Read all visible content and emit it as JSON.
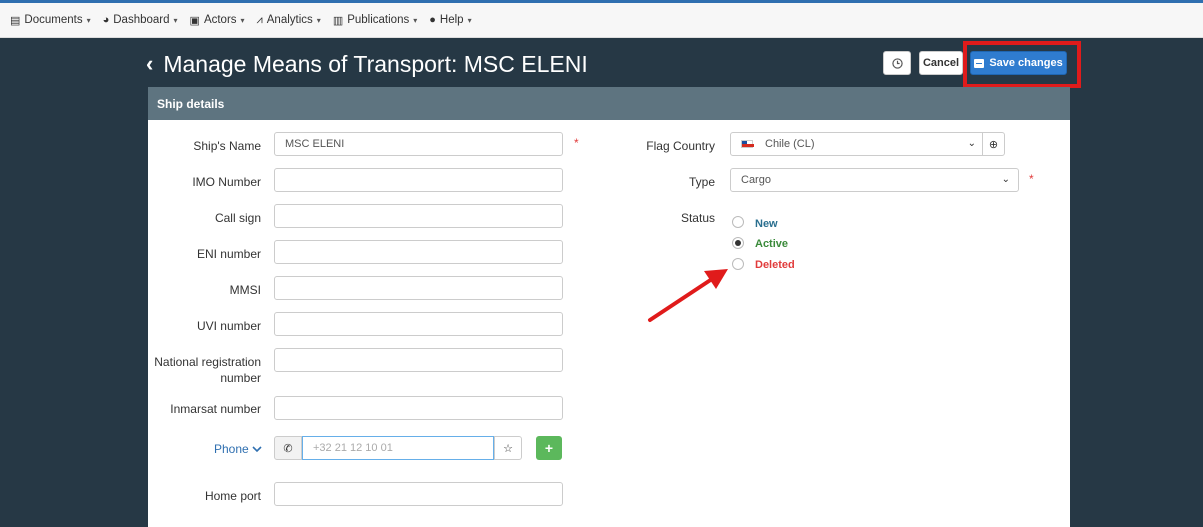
{
  "nav": {
    "items": [
      {
        "label": "Documents",
        "icon": "document-icon"
      },
      {
        "label": "Dashboard",
        "icon": "dashboard-icon"
      },
      {
        "label": "Actors",
        "icon": "id-card-icon"
      },
      {
        "label": "Analytics",
        "icon": "chart-icon"
      },
      {
        "label": "Publications",
        "icon": "book-icon"
      },
      {
        "label": "Help",
        "icon": "question-icon"
      }
    ]
  },
  "header": {
    "title": "Manage Means of Transport: MSC ELENI",
    "cancel_label": "Cancel",
    "save_label": "Save changes"
  },
  "panel": {
    "title": "Ship details"
  },
  "form": {
    "ship_name": {
      "label": "Ship's Name",
      "value": "MSC ELENI",
      "required": "*"
    },
    "imo_number": {
      "label": "IMO Number",
      "value": ""
    },
    "call_sign": {
      "label": "Call sign",
      "value": ""
    },
    "eni_number": {
      "label": "ENI number",
      "value": ""
    },
    "mmsi": {
      "label": "MMSI",
      "value": ""
    },
    "uvi_number": {
      "label": "UVI number",
      "value": ""
    },
    "national_registration": {
      "label_line1": "National registration",
      "label_line2": "number",
      "value": ""
    },
    "inmarsat_number": {
      "label": "Inmarsat number",
      "value": ""
    },
    "phone": {
      "label": "Phone",
      "placeholder": "+32 21 12 10 01"
    },
    "home_port": {
      "label": "Home port",
      "value": ""
    },
    "flag_country": {
      "label": "Flag Country",
      "value": "Chile (CL)"
    },
    "type": {
      "label": "Type",
      "value": "Cargo",
      "required": "*"
    },
    "status": {
      "label": "Status",
      "options": [
        {
          "label": "New",
          "color": "#2a6f8f",
          "checked": false
        },
        {
          "label": "Active",
          "color": "#3a8a3a",
          "checked": true
        },
        {
          "label": "Deleted",
          "color": "#e13b3b",
          "checked": false
        }
      ]
    }
  },
  "colors": {
    "background": "#263845",
    "panel_header": "#5e7480",
    "save_button": "#2f7ccf",
    "annotation": "#e01b1b"
  }
}
